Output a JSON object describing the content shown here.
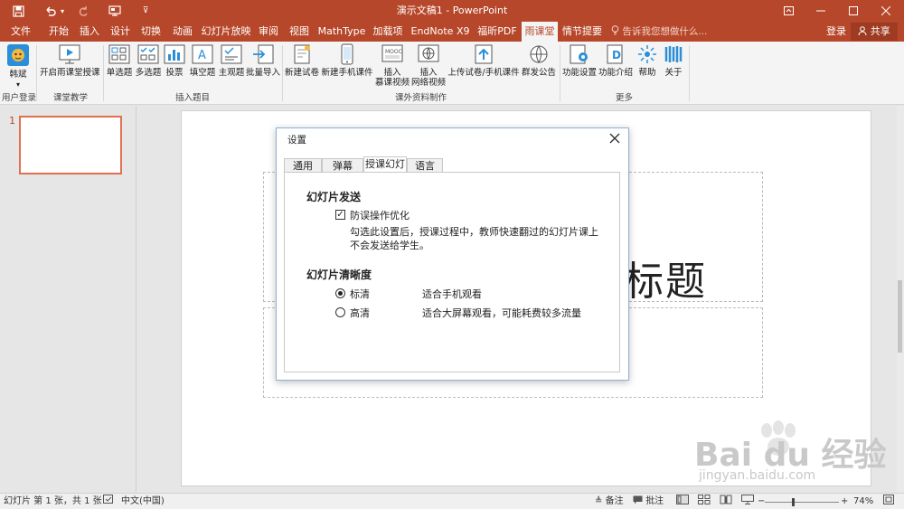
{
  "titlebar": {
    "title": "演示文稿1 - PowerPoint",
    "quickaccess": [
      "save-icon",
      "undo-icon",
      "redo-icon",
      "present-icon",
      "customize-icon"
    ],
    "window_buttons": [
      "ribbon-display-icon",
      "minimize-icon",
      "maximize-icon",
      "close-icon"
    ]
  },
  "tabs": [
    {
      "label": "文件"
    },
    {
      "label": "开始"
    },
    {
      "label": "插入"
    },
    {
      "label": "设计"
    },
    {
      "label": "切换"
    },
    {
      "label": "动画"
    },
    {
      "label": "幻灯片放映"
    },
    {
      "label": "审阅"
    },
    {
      "label": "视图"
    },
    {
      "label": "MathType"
    },
    {
      "label": "加载项"
    },
    {
      "label": "EndNote X9"
    },
    {
      "label": "福昕PDF"
    },
    {
      "label": "雨课堂"
    },
    {
      "label": "情节提要"
    }
  ],
  "tellme": "告诉我您想做什么...",
  "login": "登录",
  "share": "共享",
  "ribbon": {
    "buttons": [
      {
        "label": "韩斌",
        "icon": "user-avatar-icon"
      },
      {
        "label": "开启雨课堂授课",
        "icon": "start-class-icon"
      },
      {
        "label": "单选题",
        "icon": "single-choice-icon"
      },
      {
        "label": "多选题",
        "icon": "multi-choice-icon"
      },
      {
        "label": "投票",
        "icon": "vote-icon"
      },
      {
        "label": "填空题",
        "icon": "fill-blank-icon"
      },
      {
        "label": "主观题",
        "icon": "subjective-icon"
      },
      {
        "label": "批量导入",
        "icon": "import-icon"
      },
      {
        "label": "新建试卷",
        "icon": "new-paper-icon"
      },
      {
        "label": "新建手机课件",
        "icon": "new-mobile-icon"
      },
      {
        "label": "插入",
        "label2": "慕课视频",
        "icon": "mooc-video-icon"
      },
      {
        "label": "插入",
        "label2": "网络视频",
        "icon": "web-video-icon"
      },
      {
        "label": "上传试卷/手机课件",
        "icon": "upload-icon"
      },
      {
        "label": "群发公告",
        "icon": "broadcast-icon"
      },
      {
        "label": "功能设置",
        "icon": "settings-icon"
      },
      {
        "label": "功能介绍",
        "icon": "intro-icon"
      },
      {
        "label": "帮助",
        "icon": "help-icon"
      },
      {
        "label": "关于",
        "icon": "about-icon"
      }
    ],
    "groups": [
      "用户登录",
      "课堂教学",
      "插入题目",
      "课外资料制作",
      "更多"
    ]
  },
  "slide": {
    "thumb_number": "1",
    "title_partial": "标题"
  },
  "dialog": {
    "title": "设置",
    "tabs": [
      "通用",
      "弹幕",
      "授课幻灯",
      "语言"
    ],
    "section1": "幻灯片发送",
    "checkbox_label": "防误操作优化",
    "checkbox_checked": true,
    "desc1": "勾选此设置后，授课过程中，教师快速翻过的幻灯片课上",
    "desc2": "不会发送给学生。",
    "section2": "幻灯片清晰度",
    "radios": [
      {
        "label": "标清",
        "desc": "适合手机观看",
        "selected": true
      },
      {
        "label": "高清",
        "desc": "适合大屏幕观看，可能耗费较多流量",
        "selected": false
      }
    ]
  },
  "statusbar": {
    "slide_info": "幻灯片 第 1 张，共 1 张",
    "language": "中文(中国)",
    "notes": "备注",
    "comments": "批注",
    "zoom": "74%"
  },
  "watermark": {
    "text": "Bai du 经验",
    "sub": "jingyan.baidu.com"
  }
}
